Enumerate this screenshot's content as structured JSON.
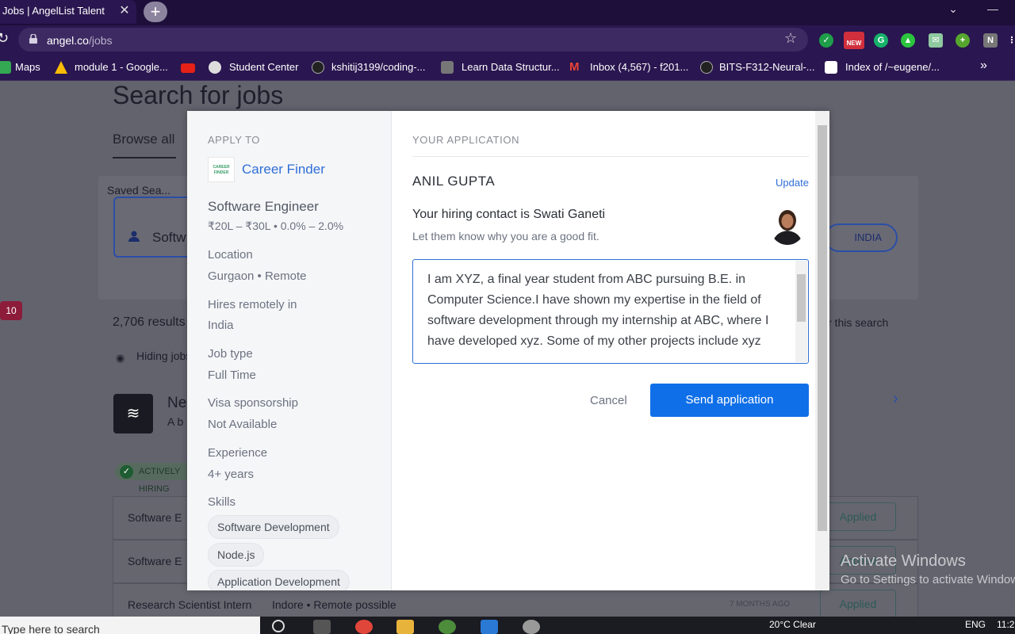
{
  "browser": {
    "tab_title": "Jobs | AngelList Talent",
    "url_host": "angel.co",
    "url_path": "/jobs",
    "bookmarks": [
      "Maps",
      "module 1 - Google...",
      "Student Center",
      "kshitij3199/coding-...",
      "Learn Data Structur...",
      "Inbox (4,567) - f201...",
      "BITS-F312-Neural-...",
      "Index of /~eugene/..."
    ],
    "more_bookmarks": "»",
    "new_badge": "NEW",
    "ext_letter": "N"
  },
  "background": {
    "heading": "Search for jobs",
    "browse_tab": "Browse all",
    "saved_searches": "Saved Sea...",
    "search_value": "Softw",
    "location_pill": "INDIA",
    "results": "2,706 results",
    "for_search": "r this search",
    "hiding": "Hiding jobs",
    "notif_count": "10",
    "company_name": "Ne",
    "company_desc": "A b",
    "active_badge": "ACTIVELY HIRING",
    "rows": [
      {
        "title": "Software E",
        "status": "Applied"
      },
      {
        "title": "Software E",
        "status": "Applied"
      },
      {
        "title": "Research Scientist Intern",
        "location": "Indore • Remote possible",
        "age": "7 MONTHS AGO",
        "status": "Applied"
      }
    ]
  },
  "modal": {
    "apply_to_label": "APPLY TO",
    "company_logo_text": "CAREER FINDER",
    "company": "Career Finder",
    "job_title": "Software Engineer",
    "salary": "₹20L – ₹30L • 0.0% – 2.0%",
    "details": [
      {
        "label": "Location",
        "value": "Gurgaon • Remote"
      },
      {
        "label": "Hires remotely in",
        "value": "India"
      },
      {
        "label": "Job type",
        "value": "Full Time"
      },
      {
        "label": "Visa sponsorship",
        "value": "Not Available"
      },
      {
        "label": "Experience",
        "value": "4+ years"
      }
    ],
    "skills_label": "Skills",
    "skills": [
      "Software Development",
      "Node.js",
      "Application Development"
    ],
    "your_application": "YOUR APPLICATION",
    "applicant_name": "ANIL GUPTA",
    "update": "Update",
    "hiring_contact": "Your hiring contact is Swati Ganeti",
    "hint": "Let them know why you are a good fit.",
    "message": "I am XYZ, a final year student from ABC pursuing B.E. in Computer Science.I have shown my expertise in the field of software development through my internship at ABC, where I have developed xyz. Some of my other projects include xyz",
    "cancel": "Cancel",
    "send": "Send application"
  },
  "watermark": {
    "line1": "Activate Windows",
    "line2": "Go to Settings to activate Windows."
  },
  "taskbar": {
    "search_placeholder": "Type here to search",
    "weather": "20°C  Clear",
    "lang": "ENG",
    "time": "11:2"
  },
  "colors": {
    "accent": "#0f6fe8",
    "link": "#2f6fd6",
    "chrome": "#2a1650"
  }
}
